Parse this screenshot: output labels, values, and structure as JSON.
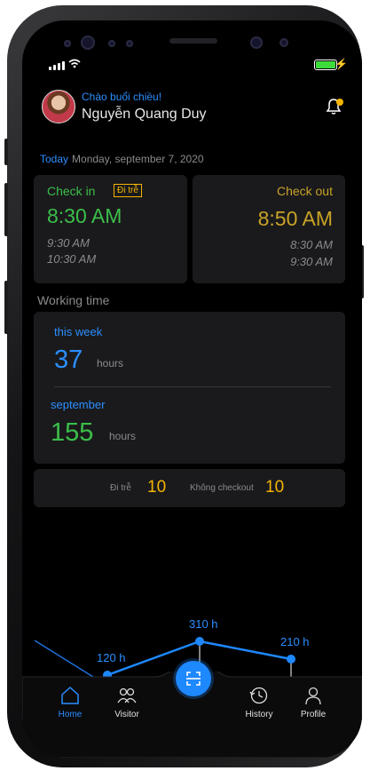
{
  "header": {
    "greeting": "Chào buổi chiều!",
    "user_name": "Nguyễn Quang Duy",
    "notification_icon": "bell-icon"
  },
  "today": {
    "label": "Today",
    "date": "Monday, september 7, 2020"
  },
  "check_in": {
    "title": "Check in",
    "late_tag": "Đi trễ",
    "time": "8:30 AM",
    "previous": [
      "9:30 AM",
      "10:30 AM"
    ]
  },
  "check_out": {
    "title": "Check out",
    "time": "8:50 AM",
    "previous": [
      "8:30 AM",
      "9:30 AM"
    ]
  },
  "working_time": {
    "label": "Working time",
    "week": {
      "title": "this week",
      "value": "37",
      "unit": "hours"
    },
    "month": {
      "title": "september",
      "value": "155",
      "unit": "hours"
    }
  },
  "stats": {
    "late_label": "Đi trễ",
    "late_value": "10",
    "no_checkout_label": "Không checkout",
    "no_checkout_value": "10"
  },
  "chart_data": {
    "type": "line",
    "values": [
      120,
      310,
      210
    ],
    "labels": [
      "120 h",
      "310 h",
      "210 h"
    ]
  },
  "tabs": [
    {
      "label": "Home",
      "icon": "home-icon",
      "active": true
    },
    {
      "label": "Visitor",
      "icon": "visitor-icon",
      "active": false
    },
    {
      "label": "History",
      "icon": "history-icon",
      "active": false
    },
    {
      "label": "Profile",
      "icon": "profile-icon",
      "active": false
    }
  ],
  "scan_button_icon": "scan-icon",
  "colors": {
    "accent_blue": "#2b8fff",
    "green": "#3bbf4a",
    "gold": "#c9a227",
    "warning": "#f4b400",
    "background": "#000000",
    "card": "#1a1a1c"
  }
}
